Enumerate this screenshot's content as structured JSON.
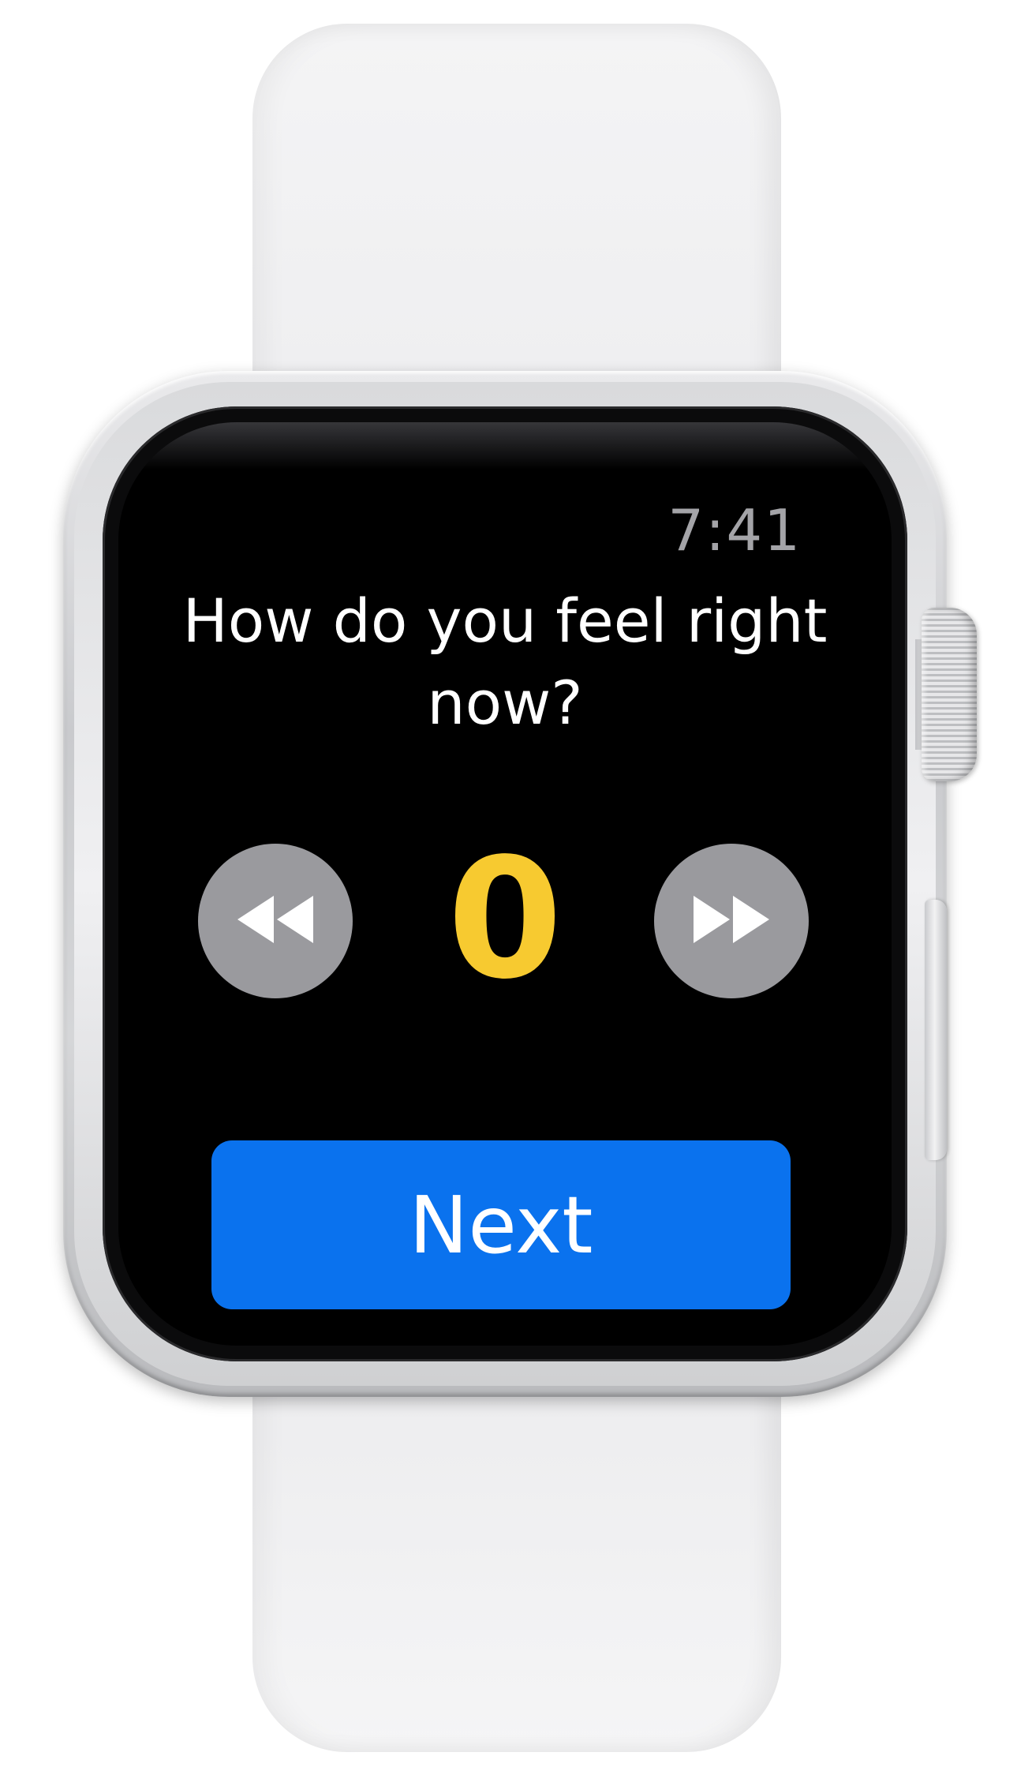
{
  "status": {
    "time": "7:41"
  },
  "prompt": {
    "question": "How do you feel right now?"
  },
  "picker": {
    "value": "0",
    "value_color": "#f7ca30",
    "rewind_icon": "rewind-icon",
    "forward_icon": "fast-forward-icon"
  },
  "actions": {
    "next_label": "Next",
    "next_color": "#0a72ee"
  },
  "device": {
    "band_color": "#f0f0f2",
    "case_color": "silver"
  }
}
